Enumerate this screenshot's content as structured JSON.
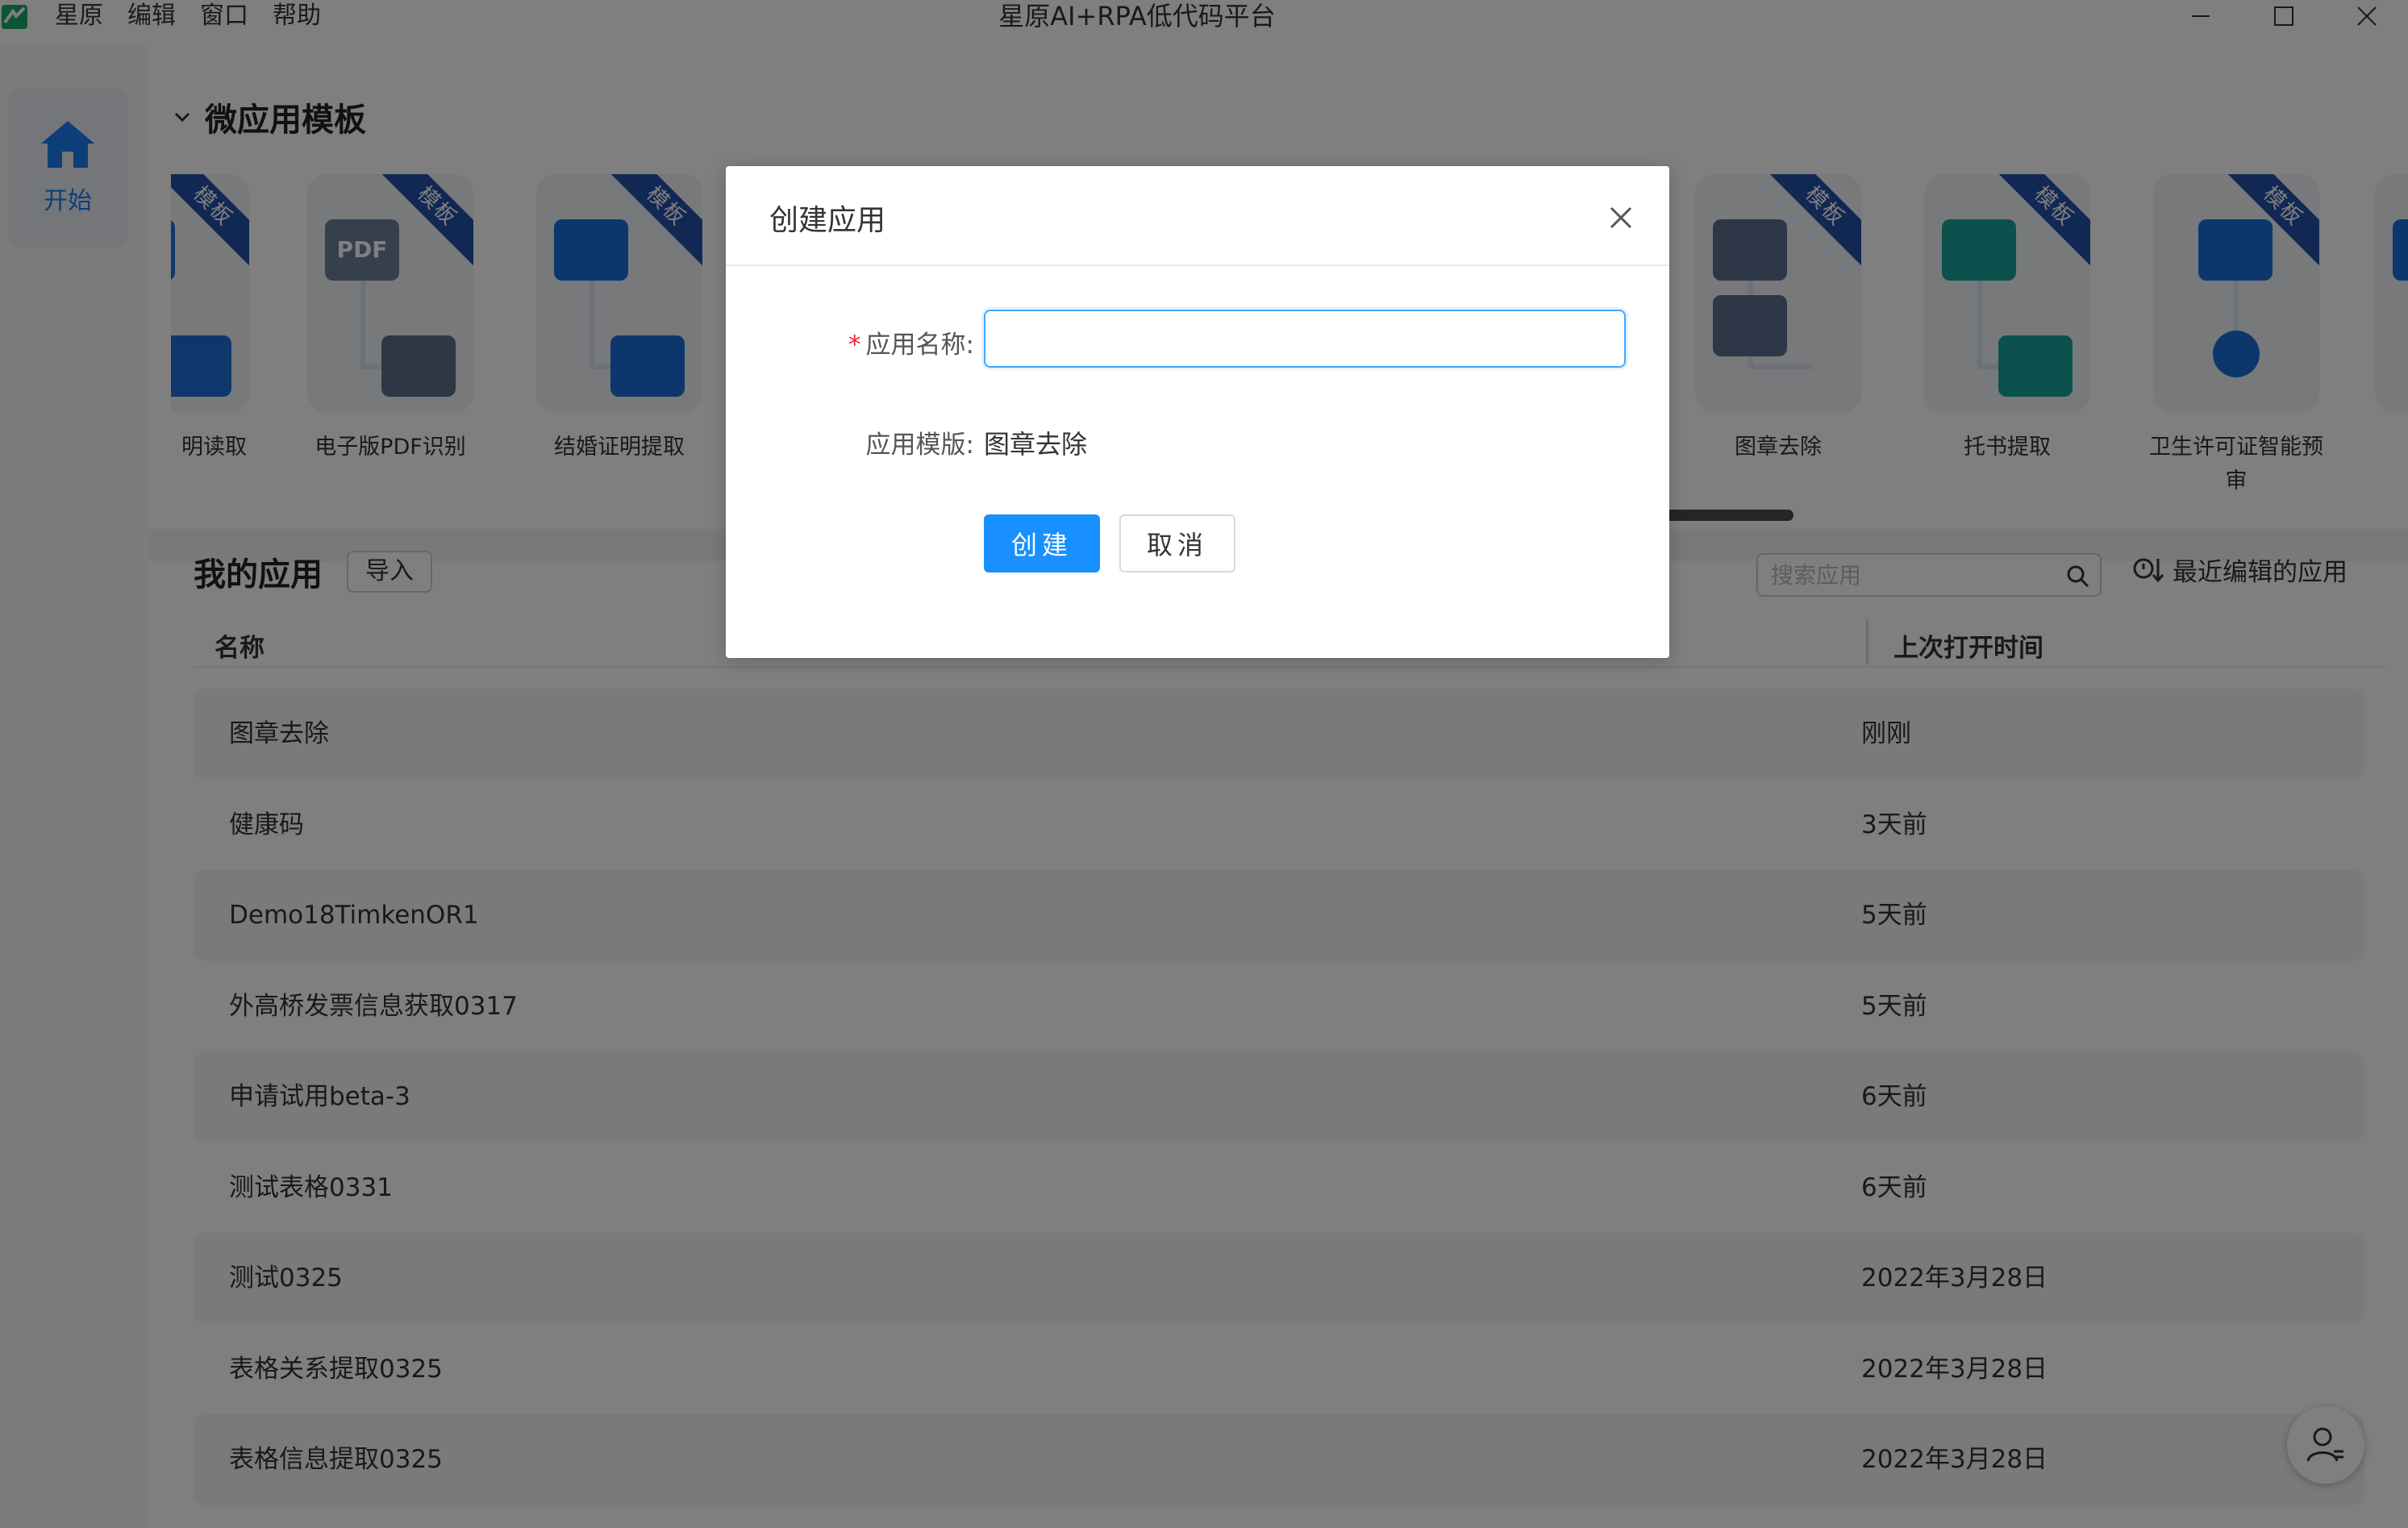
{
  "window": {
    "title": "星原AI+RPA低代码平台",
    "menu": [
      "星原",
      "编辑",
      "窗口",
      "帮助"
    ]
  },
  "sidebar": {
    "start_label": "开始"
  },
  "templates": {
    "section_title": "微应用模板",
    "badge": "模板",
    "items": [
      {
        "name": "明读取",
        "color": "#1f6fd6"
      },
      {
        "name": "电子版PDF识别",
        "color": "#6a7f9a"
      },
      {
        "name": "结婚证明提取",
        "color": "#1a6fd9"
      },
      {
        "name": "图章去除",
        "color": "#5b6f8f"
      },
      {
        "name": "托书提取",
        "color": "#17a29a"
      },
      {
        "name": "卫生许可证智能预审",
        "color": "#1a6fd9"
      },
      {
        "name": "",
        "color": "#1a6fd9"
      }
    ]
  },
  "my_apps": {
    "title": "我的应用",
    "import_label": "导入",
    "search_placeholder": "搜索应用",
    "sort_label": "最近编辑的应用",
    "columns": {
      "name": "名称",
      "last_opened": "上次打开时间"
    },
    "rows": [
      {
        "name": "图章去除",
        "time": "刚刚"
      },
      {
        "name": "健康码",
        "time": "3天前"
      },
      {
        "name": "Demo18TimkenOR1",
        "time": "5天前"
      },
      {
        "name": "外高桥发票信息获取0317",
        "time": "5天前"
      },
      {
        "name": "申请试用beta-3",
        "time": "6天前"
      },
      {
        "name": "测试表格0331",
        "time": "6天前"
      },
      {
        "name": "测试0325",
        "time": "2022年3月28日"
      },
      {
        "name": "表格关系提取0325",
        "time": "2022年3月28日"
      },
      {
        "name": "表格信息提取0325",
        "time": "2022年3月28日"
      }
    ]
  },
  "dialog": {
    "title": "创建应用",
    "name_label": "应用名称:",
    "name_value": "",
    "template_label": "应用模版:",
    "template_value": "图章去除",
    "create_label": "创建",
    "cancel_label": "取消"
  },
  "colors": {
    "accent": "#1890ff",
    "required": "#f5222d",
    "badge": "#2450a8",
    "overlay": "rgba(0,0,0,0.5)"
  },
  "icons": {
    "app_logo": "app-logo",
    "home": "home-icon",
    "collapse": "chevron-down-icon",
    "search": "search-icon",
    "sort": "clock-sort-icon",
    "close": "close-icon",
    "support": "user-support-icon"
  }
}
